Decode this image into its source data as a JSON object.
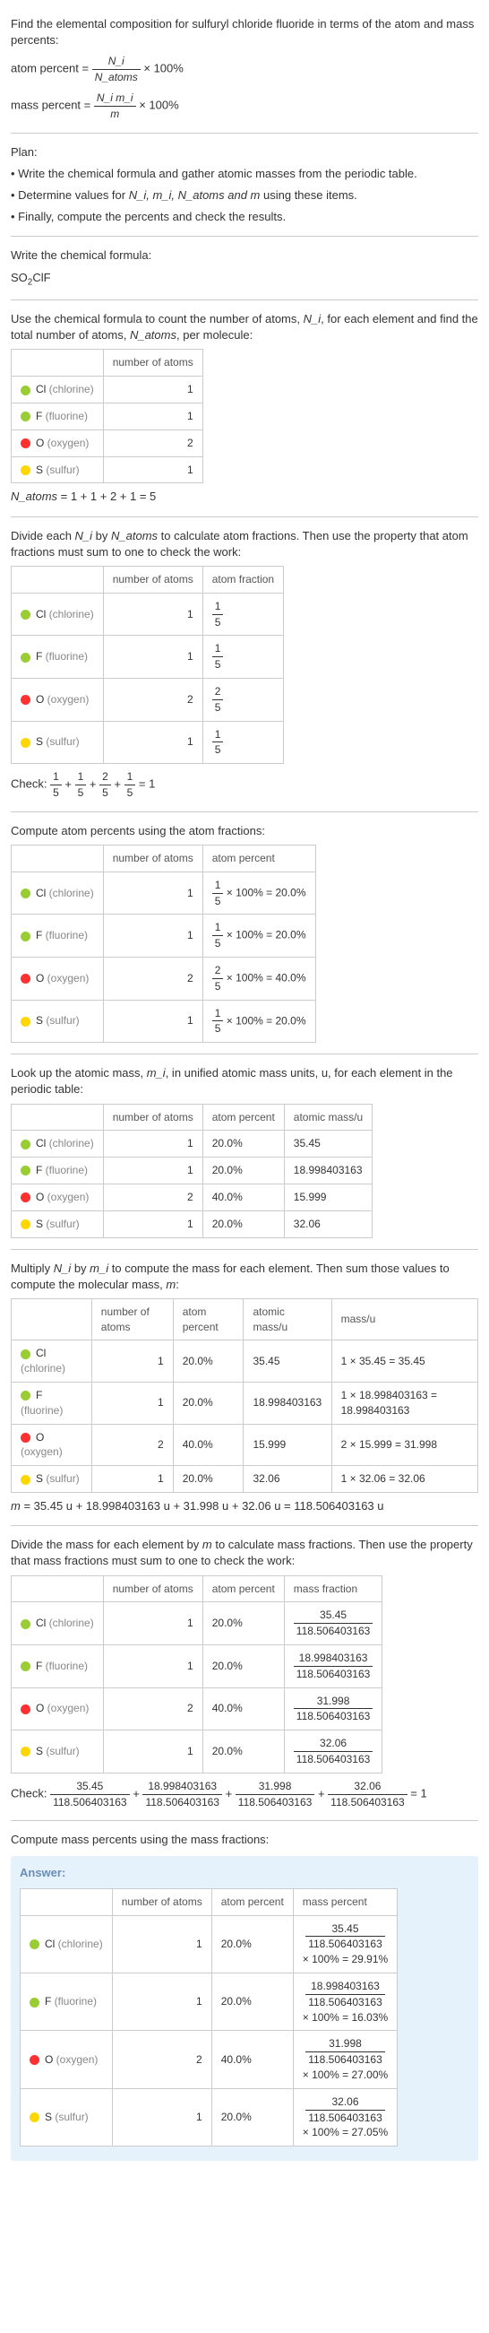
{
  "intro": {
    "line1": "Find the elemental composition for sulfuryl chloride fluoride in terms of the atom and mass percents:",
    "atom_label": "atom percent =",
    "atom_num": "N_i",
    "atom_den": "N_atoms",
    "times100": "× 100%",
    "mass_label": "mass percent =",
    "mass_num": "N_i m_i",
    "mass_den": "m"
  },
  "plan": {
    "h": "Plan:",
    "b1": "• Write the chemical formula and gather atomic masses from the periodic table.",
    "b2_a": "• Determine values for ",
    "b2_b": " using these items.",
    "b2_vars": "N_i, m_i, N_atoms and m",
    "b3": "• Finally, compute the percents and check the results."
  },
  "formula": {
    "h": "Write the chemical formula:",
    "f_main": "SO",
    "f_sub": "2",
    "f_tail": "ClF"
  },
  "count": {
    "h_a": "Use the chemical formula to count the number of atoms, ",
    "h_b": ", for each element and find the total number of atoms, ",
    "h_c": ", per molecule:",
    "ni": "N_i",
    "natoms": "N_atoms",
    "col1": "number of atoms",
    "rows": [
      {
        "el": "Cl",
        "name": "(chlorine)",
        "n": "1",
        "color": "#9ACD32"
      },
      {
        "el": "F",
        "name": "(fluorine)",
        "n": "1",
        "color": "#9ACD32"
      },
      {
        "el": "O",
        "name": "(oxygen)",
        "n": "2",
        "color": "#FF3030"
      },
      {
        "el": "S",
        "name": "(sulfur)",
        "n": "1",
        "color": "#FFD700"
      }
    ],
    "sum_a": "N_atoms",
    "sum_b": " = 1 + 1 + 2 + 1 = 5"
  },
  "frac": {
    "h_a": "Divide each ",
    "h_b": " by ",
    "h_c": " to calculate atom fractions. Then use the property that atom fractions must sum to one to check the work:",
    "col2": "atom fraction",
    "rows": [
      {
        "el": "Cl",
        "name": "(chlorine)",
        "n": "1",
        "fn": "1",
        "fd": "5",
        "color": "#9ACD32"
      },
      {
        "el": "F",
        "name": "(fluorine)",
        "n": "1",
        "fn": "1",
        "fd": "5",
        "color": "#9ACD32"
      },
      {
        "el": "O",
        "name": "(oxygen)",
        "n": "2",
        "fn": "2",
        "fd": "5",
        "color": "#FF3030"
      },
      {
        "el": "S",
        "name": "(sulfur)",
        "n": "1",
        "fn": "1",
        "fd": "5",
        "color": "#FFD700"
      }
    ],
    "check_label": "Check: ",
    "check_eq": " = 1"
  },
  "atompct": {
    "h": "Compute atom percents using the atom fractions:",
    "col2": "atom percent",
    "rows": [
      {
        "el": "Cl",
        "name": "(chlorine)",
        "n": "1",
        "fn": "1",
        "fd": "5",
        "pct": "× 100% = 20.0%",
        "color": "#9ACD32"
      },
      {
        "el": "F",
        "name": "(fluorine)",
        "n": "1",
        "fn": "1",
        "fd": "5",
        "pct": "× 100% = 20.0%",
        "color": "#9ACD32"
      },
      {
        "el": "O",
        "name": "(oxygen)",
        "n": "2",
        "fn": "2",
        "fd": "5",
        "pct": "× 100% = 40.0%",
        "color": "#FF3030"
      },
      {
        "el": "S",
        "name": "(sulfur)",
        "n": "1",
        "fn": "1",
        "fd": "5",
        "pct": "× 100% = 20.0%",
        "color": "#FFD700"
      }
    ]
  },
  "atomicmass": {
    "h_a": "Look up the atomic mass, ",
    "h_b": ", in unified atomic mass units, u, for each element in the periodic table:",
    "mi": "m_i",
    "col3": "atomic mass/u",
    "rows": [
      {
        "el": "Cl",
        "name": "(chlorine)",
        "n": "1",
        "p": "20.0%",
        "m": "35.45",
        "color": "#9ACD32"
      },
      {
        "el": "F",
        "name": "(fluorine)",
        "n": "1",
        "p": "20.0%",
        "m": "18.998403163",
        "color": "#9ACD32"
      },
      {
        "el": "O",
        "name": "(oxygen)",
        "n": "2",
        "p": "40.0%",
        "m": "15.999",
        "color": "#FF3030"
      },
      {
        "el": "S",
        "name": "(sulfur)",
        "n": "1",
        "p": "20.0%",
        "m": "32.06",
        "color": "#FFD700"
      }
    ]
  },
  "mult": {
    "h_a": "Multiply ",
    "h_b": " by ",
    "h_c": " to compute the mass for each element. Then sum those values to compute the molecular mass, ",
    "h_d": ":",
    "m": "m",
    "col4": "mass/u",
    "rows": [
      {
        "el": "Cl",
        "name": "(chlorine)",
        "n": "1",
        "p": "20.0%",
        "am": "35.45",
        "calc": "1 × 35.45 = 35.45",
        "color": "#9ACD32"
      },
      {
        "el": "F",
        "name": "(fluorine)",
        "n": "1",
        "p": "20.0%",
        "am": "18.998403163",
        "calc": "1 × 18.998403163 = 18.998403163",
        "color": "#9ACD32"
      },
      {
        "el": "O",
        "name": "(oxygen)",
        "n": "2",
        "p": "40.0%",
        "am": "15.999",
        "calc": "2 × 15.999 = 31.998",
        "color": "#FF3030"
      },
      {
        "el": "S",
        "name": "(sulfur)",
        "n": "1",
        "p": "20.0%",
        "am": "32.06",
        "calc": "1 × 32.06 = 32.06",
        "color": "#FFD700"
      }
    ],
    "sum_a": "m",
    "sum_b": " = 35.45 u + 18.998403163 u + 31.998 u + 32.06 u = 118.506403163 u"
  },
  "massfrac": {
    "h_a": "Divide the mass for each element by ",
    "h_b": " to calculate mass fractions. Then use the property that mass fractions must sum to one to check the work:",
    "col3": "mass fraction",
    "rows": [
      {
        "el": "Cl",
        "name": "(chlorine)",
        "n": "1",
        "p": "20.0%",
        "fn": "35.45",
        "fd": "118.506403163",
        "color": "#9ACD32"
      },
      {
        "el": "F",
        "name": "(fluorine)",
        "n": "1",
        "p": "20.0%",
        "fn": "18.998403163",
        "fd": "118.506403163",
        "color": "#9ACD32"
      },
      {
        "el": "O",
        "name": "(oxygen)",
        "n": "2",
        "p": "40.0%",
        "fn": "31.998",
        "fd": "118.506403163",
        "color": "#FF3030"
      },
      {
        "el": "S",
        "name": "(sulfur)",
        "n": "1",
        "p": "20.0%",
        "fn": "32.06",
        "fd": "118.506403163",
        "color": "#FFD700"
      }
    ],
    "check_eq": " = 1"
  },
  "masspct": {
    "h": "Compute mass percents using the mass fractions:",
    "answer": "Answer:",
    "col3": "mass percent",
    "rows": [
      {
        "el": "Cl",
        "name": "(chlorine)",
        "n": "1",
        "p": "20.0%",
        "fn": "35.45",
        "fd": "118.506403163",
        "r": "× 100% = 29.91%",
        "color": "#9ACD32"
      },
      {
        "el": "F",
        "name": "(fluorine)",
        "n": "1",
        "p": "20.0%",
        "fn": "18.998403163",
        "fd": "118.506403163",
        "r": "× 100% = 16.03%",
        "color": "#9ACD32"
      },
      {
        "el": "O",
        "name": "(oxygen)",
        "n": "2",
        "p": "40.0%",
        "fn": "31.998",
        "fd": "118.506403163",
        "r": "× 100% = 27.00%",
        "color": "#FF3030"
      },
      {
        "el": "S",
        "name": "(sulfur)",
        "n": "1",
        "p": "20.0%",
        "fn": "32.06",
        "fd": "118.506403163",
        "r": "× 100% = 27.05%",
        "color": "#FFD700"
      }
    ]
  }
}
